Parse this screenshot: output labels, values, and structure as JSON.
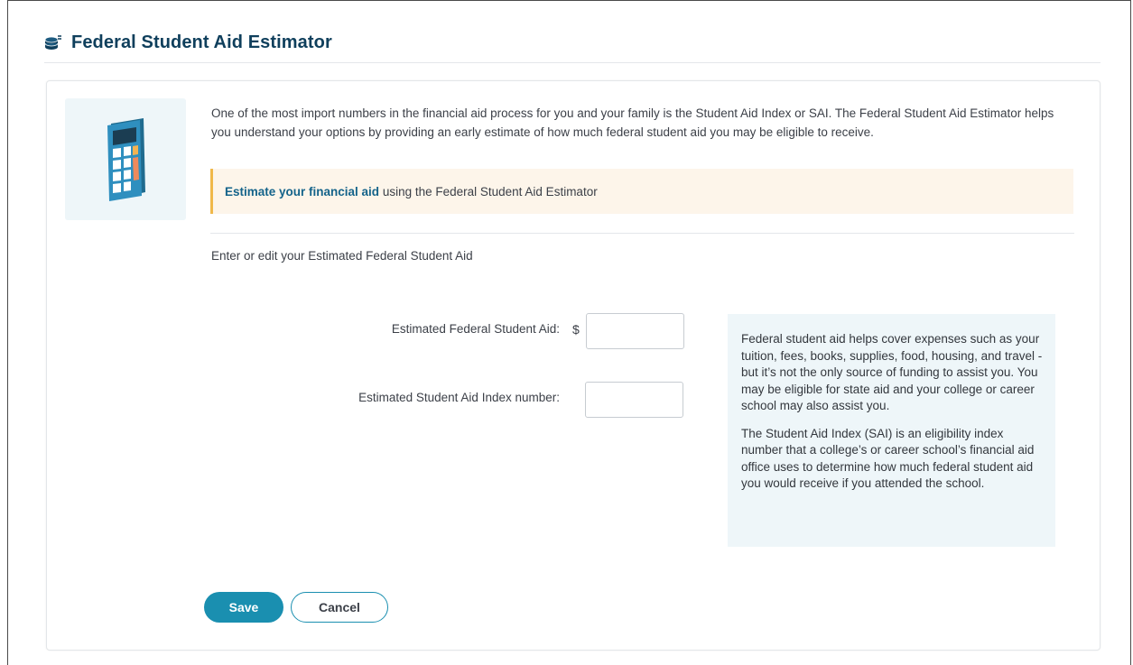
{
  "header": {
    "title": "Federal Student Aid Estimator",
    "icon": "coins-icon"
  },
  "intro": {
    "icon": "calculator-icon",
    "text": "One of the most import numbers in the financial aid process for you and your family is the Student Aid Index or SAI. The Federal Student Aid Estimator helps you understand your options by providing an early estimate of how much federal student aid you may be eligible to receive."
  },
  "callout": {
    "link_text": "Estimate your financial aid",
    "rest_text": " using the Federal Student Aid Estimator"
  },
  "form": {
    "subhead": "Enter or edit your Estimated Federal Student Aid",
    "aid_label": "Estimated Federal Student Aid:",
    "currency_symbol": "$",
    "aid_value": "",
    "sai_label": "Estimated Student Aid Index number:",
    "sai_value": ""
  },
  "info": {
    "paragraph1": "Federal student aid helps cover expenses such as your tuition, fees, books, supplies, food, housing, and travel - but it’s not the only source of funding to assist you. You may be eligible for state aid and your college or career school may also assist you.",
    "paragraph2": "The Student Aid Index (SAI) is an eligibility index number that a college’s or career school’s financial aid office uses to determine how much federal student aid you would receive if you attended the school."
  },
  "actions": {
    "save_label": "Save",
    "cancel_label": "Cancel"
  },
  "colors": {
    "title": "#0f3f5c",
    "link": "#14638a",
    "primary_button": "#1a8fb0",
    "callout_bg": "#fdf5ea",
    "callout_accent": "#f0b84a",
    "info_bg": "#eef6f9"
  }
}
